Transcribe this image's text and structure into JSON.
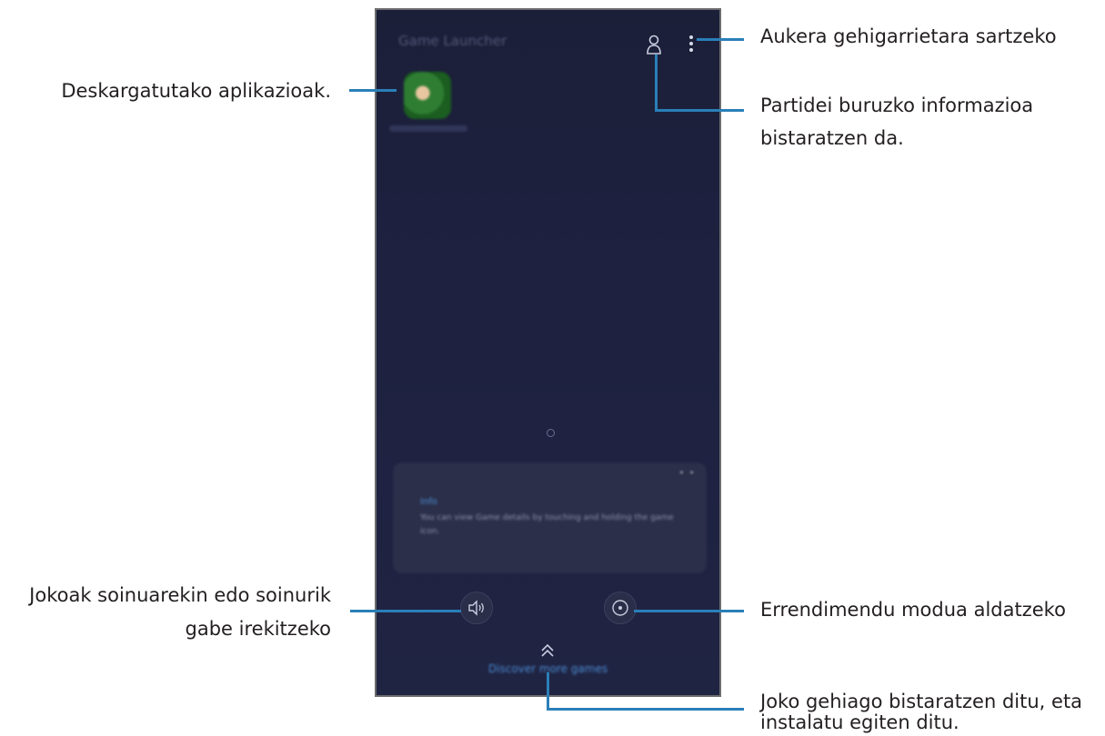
{
  "callouts": {
    "more_options": "Aukera gehigarrietara sartzeko",
    "downloaded_apps": "Deskargatutako aplikazioak.",
    "game_info_line1": "Partidei buruzko informazioa",
    "game_info_line2": "bistaratzen da.",
    "sound_toggle_line1": "Jokoak soinuarekin edo soinurik",
    "sound_toggle_line2": "gabe irekitzeko",
    "performance_mode": "Errendimendu modua aldatzeko",
    "discover_line1": "Joko gehiago bistaratzen ditu, eta",
    "discover_line2": "instalatu egiten ditu."
  },
  "phone": {
    "title": "Game Launcher",
    "tip_label": "Info",
    "tip_text": "You can view Game details by touching and holding the game icon.",
    "discover_label": "Discover more games"
  },
  "colors": {
    "leader_line": "#2a7fb8",
    "screen_bg": "#1e2140"
  }
}
